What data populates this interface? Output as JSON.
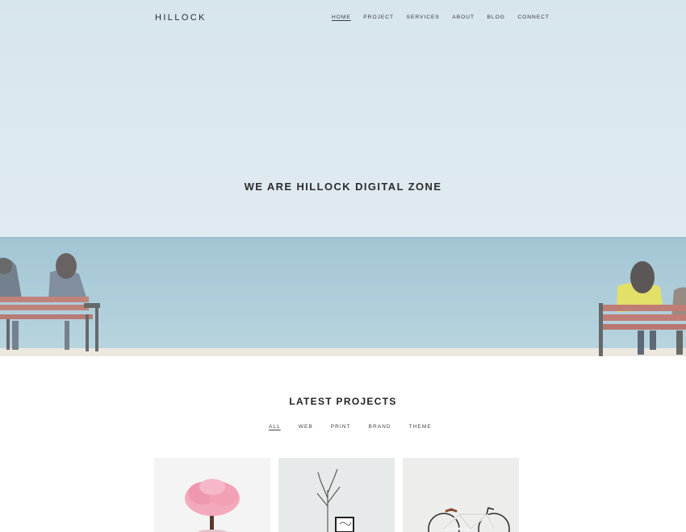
{
  "header": {
    "brand": "HILLOCK",
    "nav": [
      {
        "label": "HOME",
        "active": true
      },
      {
        "label": "PROJECT",
        "active": false
      },
      {
        "label": "SERVICES",
        "active": false
      },
      {
        "label": "ABOUT",
        "active": false
      },
      {
        "label": "BLOG",
        "active": false
      },
      {
        "label": "CONNECT",
        "active": false
      }
    ]
  },
  "hero": {
    "title": "WE ARE HILLOCK DIGITAL ZONE"
  },
  "projects": {
    "title": "LATEST PROJECTS",
    "filters": [
      {
        "label": "ALL",
        "active": true
      },
      {
        "label": "WEB",
        "active": false
      },
      {
        "label": "PRINT",
        "active": false
      },
      {
        "label": "BRAND",
        "active": false
      },
      {
        "label": "THEME",
        "active": false
      }
    ],
    "cards": [
      {
        "icon": "cherry-blossom-tree-image"
      },
      {
        "icon": "bare-branch-vase-image"
      },
      {
        "icon": "bicycle-image"
      }
    ]
  },
  "colors": {
    "sky": "#cddfe9",
    "sea": "#9cc3d3",
    "bench": "#b4574a",
    "text": "#2c2c2c"
  }
}
